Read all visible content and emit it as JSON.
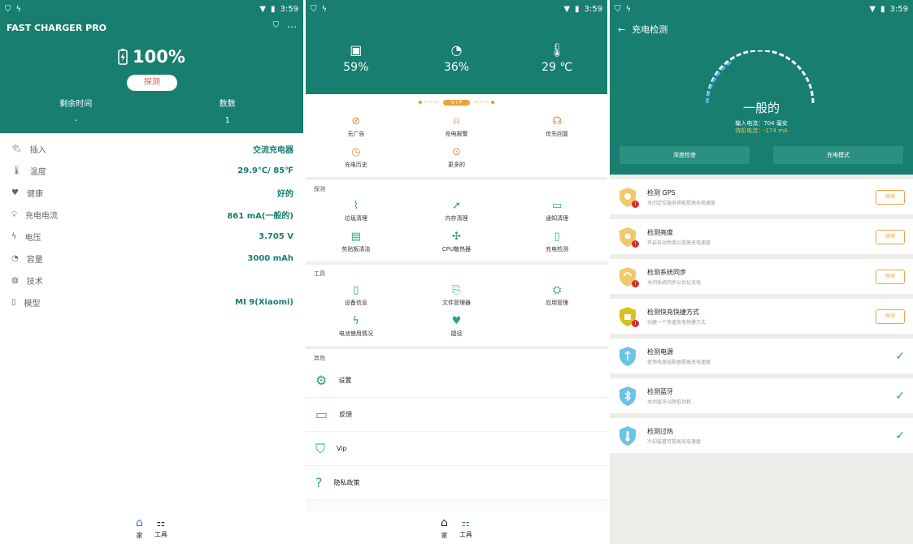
{
  "status": {
    "time": "3:59"
  },
  "p1": {
    "app_title": "FAST CHARGER PRO",
    "battery_percent": "100%",
    "detect_label": "探测",
    "stats": [
      {
        "label": "剩余时间",
        "value": "-"
      },
      {
        "label": "数数",
        "value": "1"
      }
    ],
    "rows": [
      {
        "key": "插入",
        "value": "交流充电器",
        "icon": "plug-icon"
      },
      {
        "key": "温度",
        "value": "29.9℃/ 85℉",
        "icon": "thermometer-icon"
      },
      {
        "key": "健康",
        "value": "好的",
        "icon": "heart-icon"
      },
      {
        "key": "充电电流",
        "value": "861 mA(一般的)",
        "icon": "bulb-icon"
      },
      {
        "key": "电压",
        "value": "3.705 V",
        "icon": "bolt-icon"
      },
      {
        "key": "容量",
        "value": "3000 mAh",
        "icon": "gauge-icon"
      },
      {
        "key": "技术",
        "value": "",
        "icon": "globe-icon"
      },
      {
        "key": "模型",
        "value": "MI 9(Xiaomi)",
        "icon": "phone-icon"
      }
    ],
    "nav": [
      {
        "label": "家",
        "icon": "home-icon"
      },
      {
        "label": "工具",
        "icon": "tools-icon"
      }
    ]
  },
  "p2": {
    "gauges": [
      {
        "value": "59%",
        "icon": "sdcard-icon"
      },
      {
        "value": "36%",
        "icon": "speedometer-icon"
      },
      {
        "value": "29 ℃",
        "icon": "thermometer-icon"
      }
    ],
    "vip_pill": "V I P",
    "vip_items": [
      {
        "label": "无广告",
        "icon": "no-ads-icon"
      },
      {
        "label": "充电报警",
        "icon": "alarm-icon"
      },
      {
        "label": "优先回复",
        "icon": "headset-icon"
      },
      {
        "label": "充电历史",
        "icon": "history-icon"
      },
      {
        "label": "更多的",
        "icon": "more-icon"
      }
    ],
    "section_detect": "探测",
    "detect_items": [
      {
        "label": "垃圾清理",
        "icon": "broom-icon"
      },
      {
        "label": "内存清理",
        "icon": "rocket-icon"
      },
      {
        "label": "通知清理",
        "icon": "chat-icon"
      },
      {
        "label": "剪贴板清洁",
        "icon": "clipboard-icon"
      },
      {
        "label": "CPU散热器",
        "icon": "fan-icon"
      },
      {
        "label": "充电检测",
        "icon": "battery-check-icon"
      }
    ],
    "section_tools": "工具",
    "tool_items": [
      {
        "label": "设备信息",
        "icon": "device-icon"
      },
      {
        "label": "文件管理器",
        "icon": "file-manager-icon"
      },
      {
        "label": "应用管理",
        "icon": "android-icon"
      },
      {
        "label": "电池使用情况",
        "icon": "battery-usage-icon"
      },
      {
        "label": "捷径",
        "icon": "heart-icon"
      }
    ],
    "section_other": "其他",
    "other_items": [
      {
        "label": "设置",
        "icon": "gear-icon"
      },
      {
        "label": "反馈",
        "icon": "feedback-icon"
      },
      {
        "label": "Vip",
        "icon": "vip-shield-icon"
      },
      {
        "label": "隐私政策",
        "icon": "question-icon"
      }
    ],
    "nav": [
      {
        "label": "家",
        "icon": "home-icon"
      },
      {
        "label": "工具",
        "icon": "tools-icon"
      }
    ]
  },
  "p3": {
    "title": "充电检测",
    "state": "一般的",
    "input_current": "输入电流：704 毫安",
    "standby_current": "待机电流：-174 mA",
    "buttons": [
      "深度检查",
      "充电模式"
    ],
    "cards": [
      {
        "title": "检测 GPS",
        "sub": "关闭定位服务将能提高充电速度",
        "action": "探测",
        "ok": false,
        "color": "#f2c86e"
      },
      {
        "title": "检测亮度",
        "sub": "开启自动亮度以提高充电速度",
        "action": "探测",
        "ok": false,
        "color": "#f2c86e"
      },
      {
        "title": "检测系统同步",
        "sub": "关闭系统同步以优化充电",
        "action": "探测",
        "ok": false,
        "color": "#f2c86e"
      },
      {
        "title": "检测快充快捷方式",
        "sub": "创建一个快速充电快捷方式",
        "action": "探测",
        "ok": false,
        "color": "#d9c021"
      },
      {
        "title": "检测电源",
        "sub": "使用电源适配器提高充电速度",
        "action": "",
        "ok": true,
        "color": "#6ec2e8"
      },
      {
        "title": "检测蓝牙",
        "sub": "关闭蓝牙以降低功耗",
        "action": "",
        "ok": true,
        "color": "#6ec2e8"
      },
      {
        "title": "检测过热",
        "sub": "冷却装置可提高充电速度",
        "action": "",
        "ok": true,
        "color": "#6ec2e8"
      }
    ]
  }
}
